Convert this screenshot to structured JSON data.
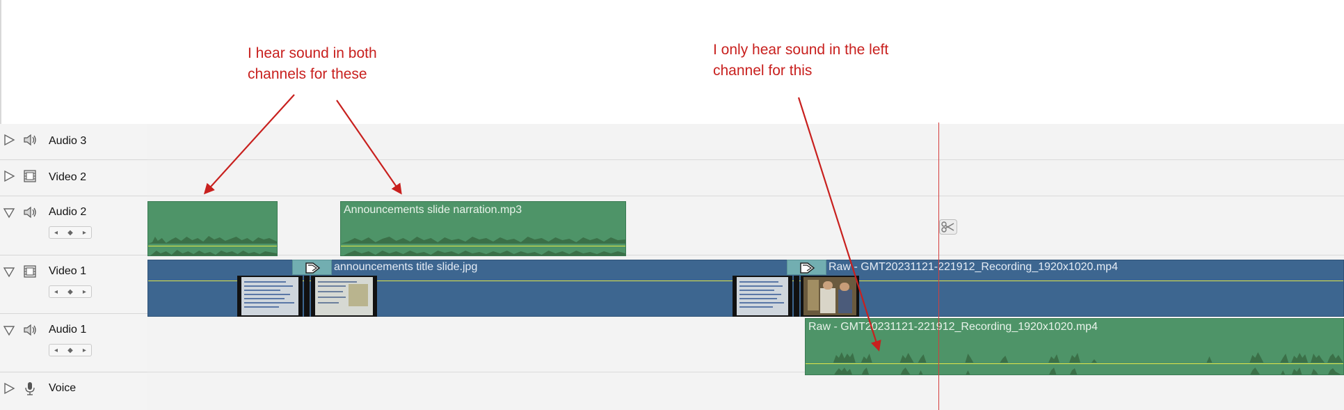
{
  "annotations": {
    "note_left": "I hear sound in both\nchannels for these",
    "note_right": "I only hear sound in the left\nchannel for this"
  },
  "tracks": [
    {
      "id": "audio3",
      "name": "Audio 3",
      "type": "audio",
      "expanded": false
    },
    {
      "id": "video2",
      "name": "Video 2",
      "type": "video",
      "expanded": false
    },
    {
      "id": "audio2",
      "name": "Audio 2",
      "type": "audio",
      "expanded": true
    },
    {
      "id": "video1",
      "name": "Video 1",
      "type": "video",
      "expanded": true
    },
    {
      "id": "audio1",
      "name": "Audio 1",
      "type": "audio",
      "expanded": true
    },
    {
      "id": "voice",
      "name": "Voice",
      "type": "voice",
      "expanded": false
    }
  ],
  "clips": {
    "audio2_clip_a": "",
    "audio2_clip_b": "Announcements slide narration.mp3",
    "video1_clip_a": "announcements title slide.jpg",
    "video1_clip_b": "Raw - GMT20231121-221912_Recording_1920x1020.mp4",
    "audio1_clip_a": "Raw - GMT20231121-221912_Recording_1920x1020.mp4"
  },
  "controls": {
    "pan_left": "◂",
    "pan_center": "◆",
    "pan_right": "▸"
  },
  "colors": {
    "annotation": "#c8201e",
    "audio_clip": "#4e9468",
    "video_clip": "#3d6690",
    "transition": "#72aeb1",
    "playhead": "#d43d3d",
    "guide_line": "#e0e64a"
  },
  "icons": {
    "expander_collapsed": "triangle-right-icon",
    "expander_expanded": "triangle-down-icon",
    "audio": "speaker-icon",
    "video": "film-icon",
    "voice": "microphone-icon",
    "scissors": "scissors-icon"
  }
}
